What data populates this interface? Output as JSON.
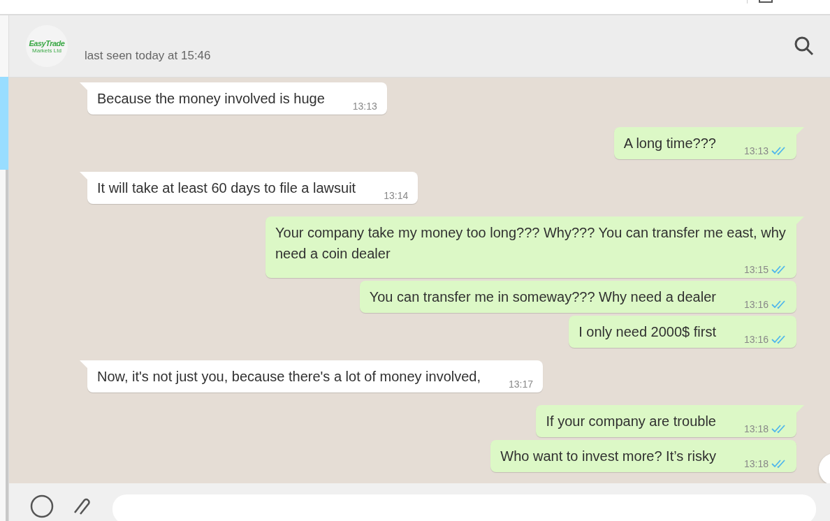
{
  "header": {
    "logo_text": "EasyTrade",
    "logo_subtext": "Markets Ltd",
    "status": "last seen today at 15:46"
  },
  "messages": [
    {
      "kind": "incoming",
      "text": "Because the money involved is huge",
      "time": "13:13",
      "tail": true
    },
    {
      "kind": "outgoing",
      "text": "A long time???",
      "time": "13:13",
      "tail": true,
      "read": true
    },
    {
      "kind": "incoming",
      "text": "It will take at least 60 days to file a lawsuit",
      "time": "13:14",
      "tail": true
    },
    {
      "kind": "outgoing",
      "text": "Your company take my money too long??? Why??? You can transfer me east, why need a coin dealer",
      "time": "13:15",
      "tail": true,
      "read": true
    },
    {
      "kind": "outgoing",
      "text": "You can transfer me in someway??? Why need a dealer",
      "time": "13:16",
      "tail": false,
      "read": true
    },
    {
      "kind": "outgoing",
      "text": "I only need 2000$ first",
      "time": "13:16",
      "tail": false,
      "read": true
    },
    {
      "kind": "incoming",
      "text": "Now, it's not just you, because there's a lot of money involved,",
      "time": "13:17",
      "tail": true
    },
    {
      "kind": "outgoing",
      "text": "If your company are trouble",
      "time": "13:18",
      "tail": true,
      "read": true
    },
    {
      "kind": "outgoing",
      "text": "Who want to invest more? It’s risky",
      "time": "13:18",
      "tail": false,
      "read": true
    }
  ]
}
